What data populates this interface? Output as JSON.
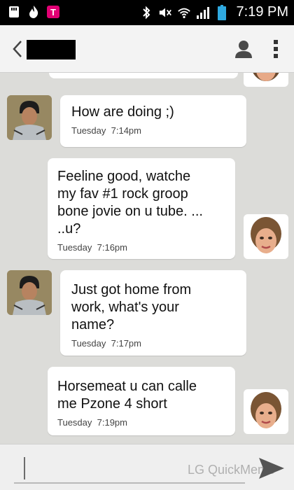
{
  "status_bar": {
    "time": "7:19 PM",
    "icons": [
      "sim-icon",
      "flame-icon",
      "t-mobile-icon",
      "bluetooth-icon",
      "mute-icon",
      "wifi-icon",
      "signal-icon",
      "battery-icon"
    ]
  },
  "header": {
    "back_icon": "chevron-left-icon",
    "contact_icon": "person-icon",
    "menu_icon": "more-vert-icon"
  },
  "messages": [
    {
      "sender": "contact",
      "text": "How are doing ;)",
      "day": "Tuesday",
      "time": "7:14pm"
    },
    {
      "sender": "me",
      "text": "Feeline good, watche\nmy fav #1 rock groop\nbone jovie on u tube. ...\n..u?",
      "day": "Tuesday",
      "time": "7:16pm"
    },
    {
      "sender": "contact",
      "text": "Just got home from\nwork, what's your\nname?",
      "day": "Tuesday",
      "time": "7:17pm"
    },
    {
      "sender": "me",
      "text": "Horsemeat u can calle\nme Pzone 4 short",
      "day": "Tuesday",
      "time": "7:19pm"
    }
  ],
  "composer": {
    "send_icon": "send-arrow-icon",
    "watermark": "LG QuickMemo"
  },
  "colors": {
    "chat_background": "#dcdcd9",
    "bubble": "#ffffff",
    "status_bar": "#000000"
  }
}
